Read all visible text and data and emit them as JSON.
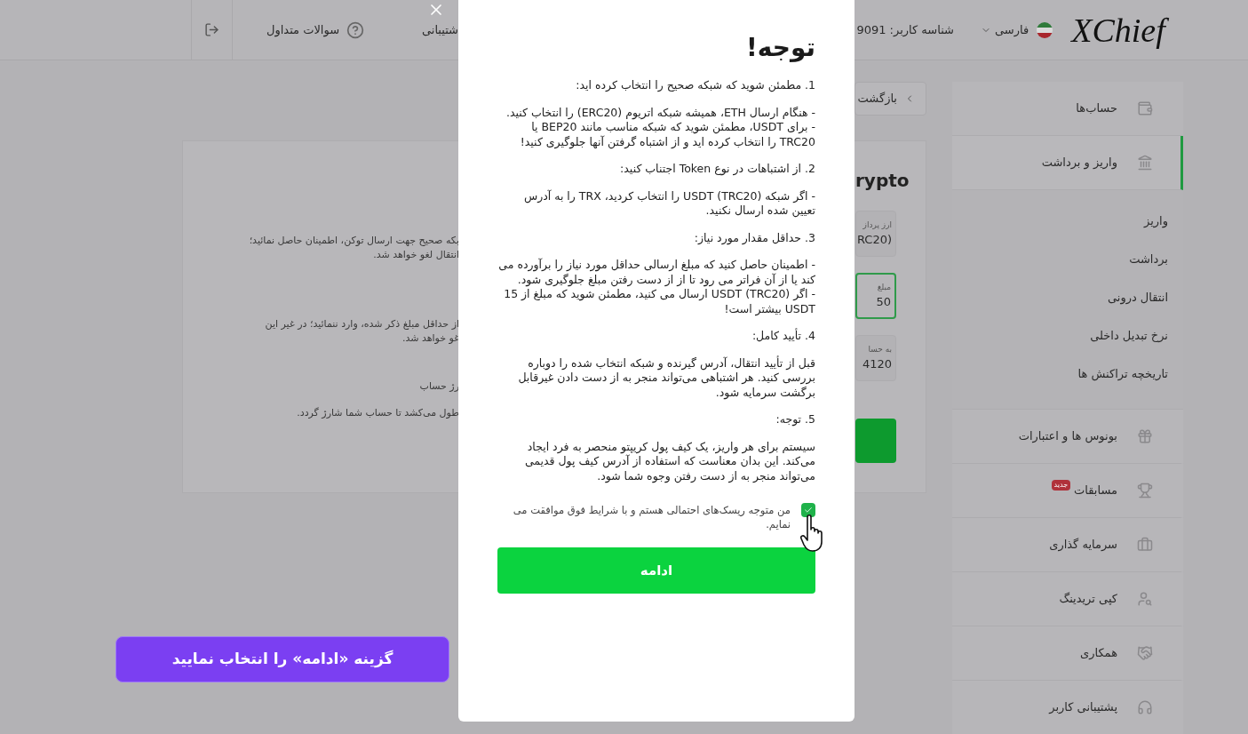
{
  "header": {
    "logo": "XChief",
    "language": "فارسی",
    "user_id": "شناسه کاربر: 9091",
    "support": "شتیبانی",
    "faq": "سوالات متداول"
  },
  "back_button": "بازگشت",
  "card": {
    "title": "rypto",
    "notes": [
      {
        "lines": [
          "بکه صحیح جهت ارسال توکن، اطمینان حاصل نمائید؛",
          "انتقال لغو خواهد شد."
        ]
      },
      {
        "lines": [
          "از حداقل مبلغ ذکر شده، وارد ننمائید؛ در غیر این",
          "غو خواهد شد."
        ]
      },
      {
        "lines": [
          "رژ حساب"
        ]
      },
      {
        "lines": [
          "طول می‌کشد تا حساب شما شارژ گردد."
        ]
      }
    ],
    "fields": [
      {
        "label": "ارز پرداز",
        "value": "RC20)",
        "selected": false
      },
      {
        "label": "مبلغ",
        "value": "50",
        "selected": true
      },
      {
        "label": "به حسا",
        "value": "4120",
        "selected": false
      }
    ]
  },
  "sidebar": {
    "items": [
      {
        "label": "حساب‌ها",
        "selected": false
      },
      {
        "label": "واریز و برداشت",
        "selected": true,
        "expanded": true,
        "children": [
          {
            "label": "واریز"
          },
          {
            "label": "برداشت"
          },
          {
            "label": "انتقال درونی"
          },
          {
            "label": "نرخ تبدیل داخلی"
          },
          {
            "label": "تاریخچه تراکنش ها"
          }
        ]
      },
      {
        "label": "بونوس ها و اعتبارات",
        "selected": false
      },
      {
        "label": "مسابقات",
        "selected": false,
        "badge": "جدید"
      },
      {
        "label": "سرمایه گذاری",
        "selected": false
      },
      {
        "label": "کپی تریدینگ",
        "selected": false
      },
      {
        "label": "همکاری",
        "selected": false
      },
      {
        "label": "پشتیبانی کاربر",
        "selected": false
      }
    ]
  },
  "modal": {
    "title": "توجه!",
    "sections": [
      {
        "heading": "1. مطمئن شوید که شبکه صحیح را انتخاب کرده اید:",
        "lines": [
          "- هنگام ارسال ETH، همیشه شبکه اتریوم (ERC20) را انتخاب کنید.",
          "- برای USDT، مطمئن شوید که شبکه مناسب مانند BEP20 یا TRC20 را انتخاب کرده اید و از اشتباه گرفتن آنها جلوگیری کنید!"
        ]
      },
      {
        "heading": "2. از اشتباهات در نوع Token اجتناب کنید:",
        "lines": [
          "- اگر شبکه (USDT (TRC20 را انتخاب کردید، TRX را به آدرس تعیین شده ارسال نکنید."
        ]
      },
      {
        "heading": "3. حداقل مقدار مورد نیاز:",
        "lines": [
          "- اطمینان حاصل کنید که مبلغ ارسالی حداقل مورد نیاز را برآورده می کند یا از آن فراتر می رود تا از از دست رفتن مبلغ جلوگیری شود.",
          "- اگر (USDT (TRC20 ارسال می کنید، مطمئن شوید که مبلغ از 15 USDT بیشتر است!"
        ]
      },
      {
        "heading": "4. تأیید کامل:",
        "lines": [
          "قبل از تأیید انتقال، آدرس گیرنده و شبکه انتخاب شده را دوباره بررسی کنید. هر اشتباهی می‌تواند منجر به از دست دادن غیرقابل برگشت سرمایه شود."
        ]
      },
      {
        "heading": "5. توجه:",
        "lines": [
          "سیستم برای هر واریز، یک کیف پول کریپتو منحصر به فرد ایجاد می‌کند. این بدان معناست که استفاده از آدرس کیف پول قدیمی می‌تواند منجر به از دست رفتن وجوه شما شود."
        ]
      }
    ],
    "agreement": {
      "label": "من متوجه ریسک‌های احتمالی هستم و با شرایط فوق موافقت می نمایم.",
      "checked": true
    },
    "continue_button": "ادامه"
  },
  "callout": "گزینه «ادامه» را انتخاب نمایید"
}
